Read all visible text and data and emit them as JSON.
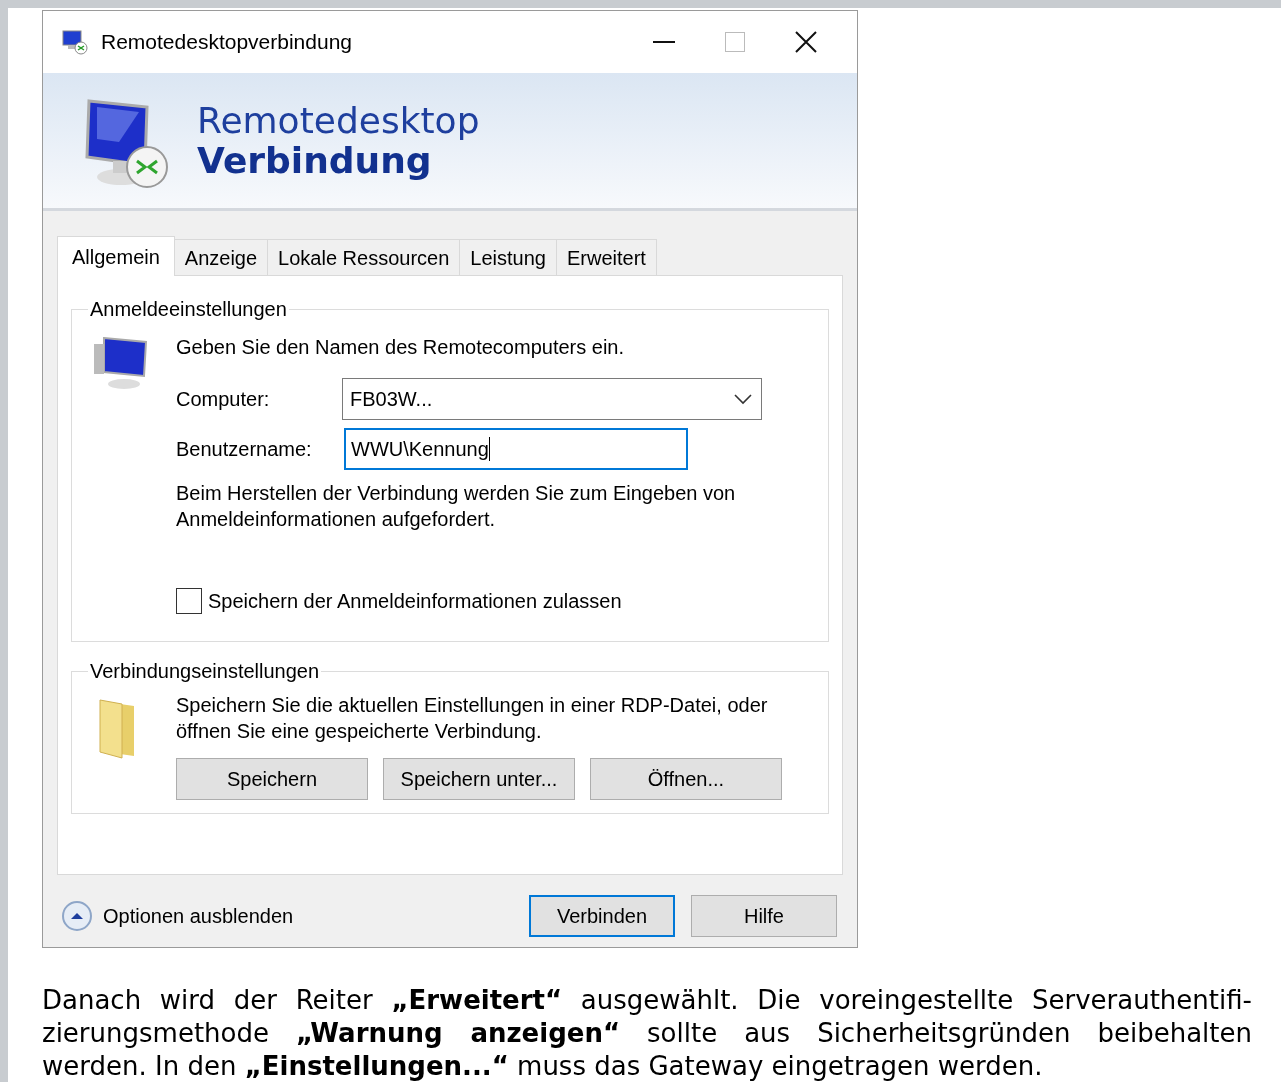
{
  "window": {
    "title": "Remotedesktopverbindung"
  },
  "banner": {
    "line_1": "Remotedesktop",
    "line_2": "Verbindung"
  },
  "tabs": [
    {
      "label": "Allgemein",
      "selected": true
    },
    {
      "label": "Anzeige",
      "selected": false
    },
    {
      "label": "Lokale Ressourcen",
      "selected": false
    },
    {
      "label": "Leistung",
      "selected": false
    },
    {
      "label": "Erweitert",
      "selected": false
    }
  ],
  "login_group": {
    "title": "Anmeldeeinstellungen",
    "intro": "Geben Sie den Namen des Remotecomputers ein.",
    "fields": [
      {
        "kind": "dropdown",
        "label": "Computer:",
        "value": "FB03W...",
        "focused": false
      },
      {
        "kind": "text",
        "label": "Benutzername:",
        "value": "WWU\\Kennung",
        "focused": true
      }
    ],
    "note": "Beim Herstellen der Verbindung werden Sie zum Eingeben von Anmeldeinformationen aufgefordert.",
    "checkbox": {
      "label": "Speichern der Anmeldeinformationen zulassen",
      "checked": false
    }
  },
  "connection_group": {
    "title": "Verbindungseinstellungen",
    "text": "Speichern Sie die aktuellen Einstellungen in einer RDP-Datei, oder öffnen Sie eine gespeicherte Verbindung.",
    "buttons": [
      "Speichern",
      "Speichern unter...",
      "Öffnen..."
    ]
  },
  "footer": {
    "toggle": "Optionen ausblenden",
    "buttons": [
      {
        "label": "Verbinden",
        "default": true
      },
      {
        "label": "Hilfe",
        "default": false
      }
    ]
  },
  "caption": "Danach wird der Reiter **„Erweitert“** ausgewählt. Die voreingestellte Serverauthentifi-zierungsmethode **„Warnung anzeigen“** sollte aus Sicherheitsgründen beibehalten werden. In den **„Einstellungen...“** muss das Gateway eingetragen werden."
}
